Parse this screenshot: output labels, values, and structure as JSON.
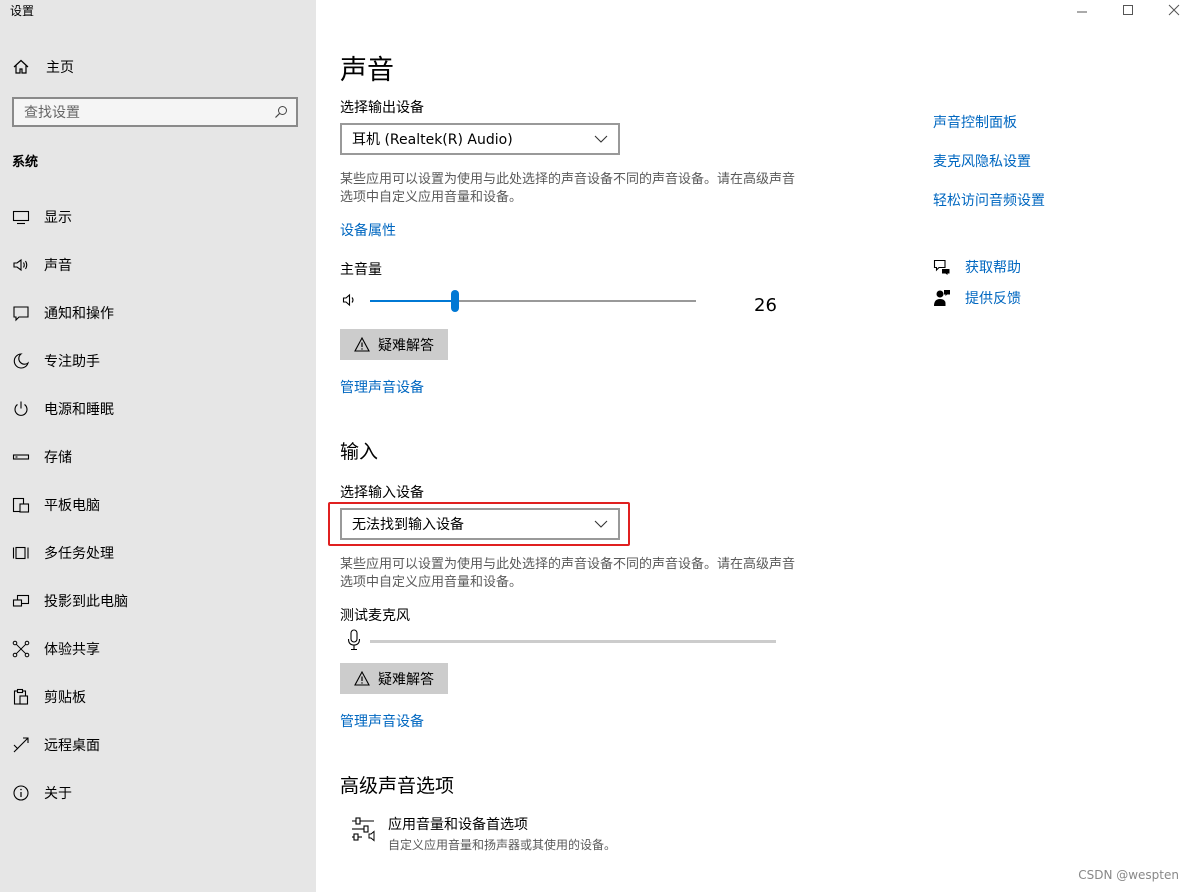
{
  "window": {
    "title": "设置",
    "controls": [
      "minimize",
      "maximize",
      "close"
    ]
  },
  "sidebar": {
    "home_label": "主页",
    "search_placeholder": "查找设置",
    "section": "系统",
    "items": [
      {
        "label": "显示",
        "icon": "display-icon"
      },
      {
        "label": "声音",
        "icon": "speaker-icon"
      },
      {
        "label": "通知和操作",
        "icon": "notification-icon"
      },
      {
        "label": "专注助手",
        "icon": "moon-icon"
      },
      {
        "label": "电源和睡眠",
        "icon": "power-icon"
      },
      {
        "label": "存储",
        "icon": "storage-icon"
      },
      {
        "label": "平板电脑",
        "icon": "tablet-icon"
      },
      {
        "label": "多任务处理",
        "icon": "multitask-icon"
      },
      {
        "label": "投影到此电脑",
        "icon": "project-icon"
      },
      {
        "label": "体验共享",
        "icon": "share-icon"
      },
      {
        "label": "剪贴板",
        "icon": "clipboard-icon"
      },
      {
        "label": "远程桌面",
        "icon": "remote-icon"
      },
      {
        "label": "关于",
        "icon": "info-icon"
      }
    ]
  },
  "main": {
    "title": "声音",
    "output": {
      "select_label": "选择输出设备",
      "selected_device": "耳机 (Realtek(R) Audio)",
      "description": "某些应用可以设置为使用与此处选择的声音设备不同的声音设备。请在高级声音选项中自定义应用音量和设备。",
      "device_properties_link": "设备属性",
      "volume_label": "主音量",
      "volume_value": "26",
      "volume_fraction": 0.26,
      "troubleshoot_label": "疑难解答",
      "manage_link": "管理声音设备"
    },
    "input": {
      "heading": "输入",
      "select_label": "选择输入设备",
      "selected_device": "无法找到输入设备",
      "description": "某些应用可以设置为使用与此处选择的声音设备不同的声音设备。请在高级声音选项中自定义应用音量和设备。",
      "test_mic_label": "测试麦克风",
      "troubleshoot_label": "疑难解答",
      "manage_link": "管理声音设备"
    },
    "advanced": {
      "heading": "高级声音选项",
      "item_title": "应用音量和设备首选项",
      "item_desc": "自定义应用音量和扬声器或其使用的设备。"
    }
  },
  "related": {
    "links": [
      "声音控制面板",
      "麦克风隐私设置",
      "轻松访问音频设置"
    ],
    "get_help": "获取帮助",
    "feedback": "提供反馈"
  },
  "watermark": "CSDN @wespten",
  "colors": {
    "accent": "#0078d4",
    "link": "#0067c0",
    "highlight": "#e02020",
    "sidebar_bg": "#e6e6e6"
  }
}
